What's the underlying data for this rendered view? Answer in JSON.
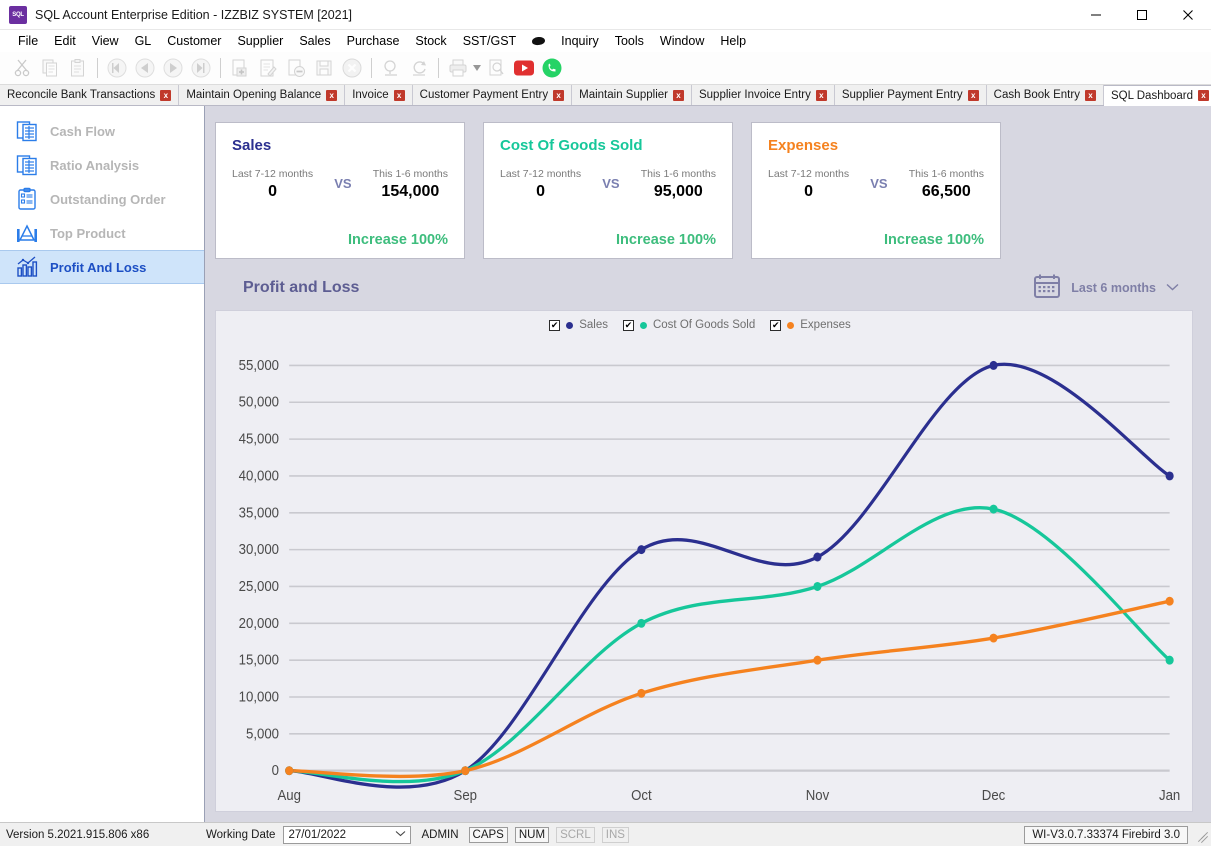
{
  "window": {
    "title": "SQL Account Enterprise Edition - IZZBIZ SYSTEM [2021]",
    "app_icon": "sql-app-icon",
    "minimize": "—",
    "maximize": "☐",
    "close": "✕"
  },
  "menu": [
    {
      "label": "File",
      "accel": "F"
    },
    {
      "label": "Edit",
      "accel": "E"
    },
    {
      "label": "View",
      "accel": "V"
    },
    {
      "label": "GL",
      "accel": "L"
    },
    {
      "label": "Customer",
      "accel": "C"
    },
    {
      "label": "Supplier",
      "accel": "u"
    },
    {
      "label": "Sales",
      "accel": "S"
    },
    {
      "label": "Purchase",
      "accel": "P"
    },
    {
      "label": "Stock",
      "accel": "k"
    },
    {
      "label": "SST/GST",
      "accel": "G"
    },
    {
      "label": "Inquiry",
      "accel": "I"
    },
    {
      "label": "Tools",
      "accel": "T"
    },
    {
      "label": "Window",
      "accel": "W"
    },
    {
      "label": "Help",
      "accel": "H"
    }
  ],
  "toolbar": {
    "buttons": [
      {
        "name": "cut-icon",
        "enabled": false
      },
      {
        "name": "copy-icon",
        "enabled": false
      },
      {
        "name": "paste-icon",
        "enabled": false
      },
      {
        "name": "first-record-icon",
        "enabled": false
      },
      {
        "name": "previous-record-icon",
        "enabled": false
      },
      {
        "name": "next-record-icon",
        "enabled": false
      },
      {
        "name": "last-record-icon",
        "enabled": false
      },
      {
        "name": "add-record-icon",
        "enabled": false
      },
      {
        "name": "edit-record-icon",
        "enabled": false
      },
      {
        "name": "delete-record-icon",
        "enabled": false
      },
      {
        "name": "save-record-icon",
        "enabled": false
      },
      {
        "name": "cancel-record-icon",
        "enabled": false
      },
      {
        "name": "search-icon",
        "enabled": false
      },
      {
        "name": "refresh-icon",
        "enabled": false
      },
      {
        "name": "print-icon",
        "enabled": false
      },
      {
        "name": "print-preview-icon",
        "enabled": false
      },
      {
        "name": "youtube-icon",
        "enabled": true
      },
      {
        "name": "whatsapp-icon",
        "enabled": true
      }
    ]
  },
  "tabs": {
    "items": [
      {
        "label": "Reconcile Bank Transactions",
        "active": false,
        "close": "x"
      },
      {
        "label": "Maintain Opening Balance",
        "active": false,
        "close": "x"
      },
      {
        "label": "Invoice",
        "active": false,
        "close": "x"
      },
      {
        "label": "Customer Payment Entry",
        "active": false,
        "close": "x"
      },
      {
        "label": "Maintain Supplier",
        "active": false,
        "close": "x"
      },
      {
        "label": "Supplier Invoice Entry",
        "active": false,
        "close": "x"
      },
      {
        "label": "Supplier Payment Entry",
        "active": false,
        "close": "x"
      },
      {
        "label": "Cash Book Entry",
        "active": false,
        "close": "x"
      },
      {
        "label": "SQL Dashboard",
        "active": true,
        "close": "x"
      }
    ],
    "combo_caret": "⌄",
    "scroll_right": "▶"
  },
  "sidebar": {
    "items": [
      {
        "label": "Cash Flow",
        "icon": "cash-flow-icon",
        "active": false
      },
      {
        "label": "Ratio Analysis",
        "icon": "ratio-analysis-icon",
        "active": false
      },
      {
        "label": "Outstanding Order",
        "icon": "outstanding-order-icon",
        "active": false
      },
      {
        "label": "Top Product",
        "icon": "top-product-icon",
        "active": false
      },
      {
        "label": "Profit And Loss",
        "icon": "profit-and-loss-icon",
        "active": true
      }
    ]
  },
  "cards": [
    {
      "title": "Sales",
      "color": "#2b2f8f",
      "left_label": "Last 7-12 months",
      "left_value": "0",
      "vs": "VS",
      "right_label": "This 1-6 months",
      "right_value": "154,000",
      "delta": "Increase 100%"
    },
    {
      "title": "Cost Of Goods Sold",
      "color": "#16c79a",
      "left_label": "Last 7-12 months",
      "left_value": "0",
      "vs": "VS",
      "right_label": "This 1-6 months",
      "right_value": "95,000",
      "delta": "Increase 100%"
    },
    {
      "title": "Expenses",
      "color": "#f5821f",
      "left_label": "Last 7-12 months",
      "left_value": "0",
      "vs": "VS",
      "right_label": "This 1-6 months",
      "right_value": "66,500",
      "delta": "Increase 100%"
    }
  ],
  "chart_header": {
    "title": "Profit and Loss",
    "range_icon": "calendar-icon",
    "range_label": "Last 6 months",
    "range_caret": "⌄"
  },
  "chart_data": {
    "type": "line",
    "title": "Profit and Loss",
    "xlabel": "",
    "ylabel": "",
    "x": [
      "Aug",
      "Sep",
      "Oct",
      "Nov",
      "Dec",
      "Jan"
    ],
    "ylim": [
      0,
      57000
    ],
    "yticks": [
      0,
      5000,
      10000,
      15000,
      20000,
      25000,
      30000,
      35000,
      40000,
      45000,
      50000,
      55000
    ],
    "ytick_labels": [
      "0",
      "5,000",
      "10,000",
      "15,000",
      "20,000",
      "25,000",
      "30,000",
      "35,000",
      "40,000",
      "45,000",
      "50,000",
      "55,000"
    ],
    "grid": true,
    "legend_position": "top-center",
    "smoothed": true,
    "markers": true,
    "series": [
      {
        "name": "Sales",
        "color": "#2b2f8f",
        "checked": true,
        "values": [
          0,
          0,
          30000,
          29000,
          55000,
          40000
        ]
      },
      {
        "name": "Cost Of Goods Sold",
        "color": "#16c79a",
        "checked": true,
        "values": [
          0,
          0,
          20000,
          25000,
          35500,
          15000
        ]
      },
      {
        "name": "Expenses",
        "color": "#f5821f",
        "checked": true,
        "values": [
          0,
          0,
          10500,
          15000,
          18000,
          23000
        ]
      }
    ]
  },
  "statusbar": {
    "version": "Version 5.2021.915.806 x86",
    "working_date_label": "Working Date",
    "working_date_value": "27/01/2022",
    "date_caret": "⌄",
    "user": "ADMIN",
    "caps": "CAPS",
    "num": "NUM",
    "scrl": "SCRL",
    "ins": "INS",
    "firebird": "WI-V3.0.7.33374 Firebird 3.0"
  }
}
